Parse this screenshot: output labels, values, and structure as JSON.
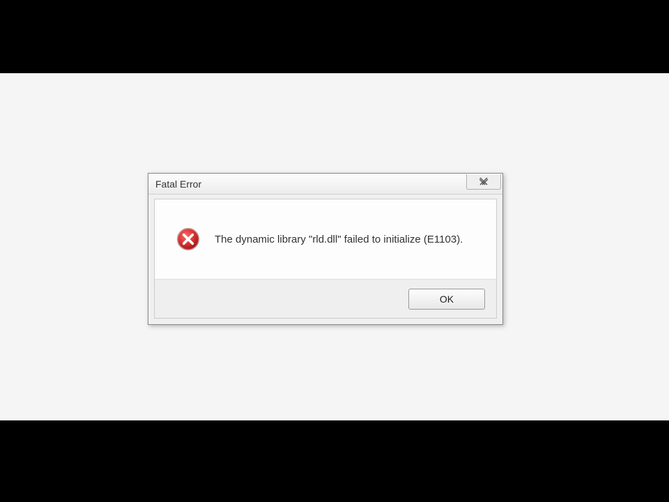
{
  "dialog": {
    "title": "Fatal Error",
    "message": "The dynamic library \"rld.dll\" failed to initialize (E1103).",
    "ok_label": "OK"
  }
}
